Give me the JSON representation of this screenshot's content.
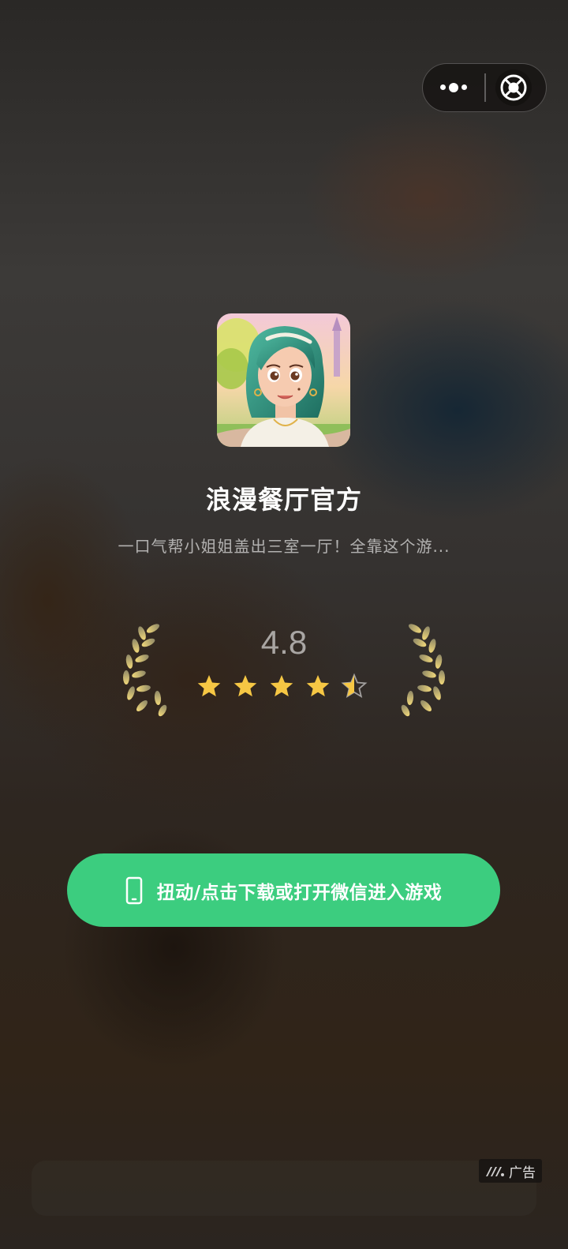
{
  "capsule": {
    "more_icon": "more-dots-icon",
    "close_icon": "target-close-icon"
  },
  "app": {
    "name": "浪漫餐厅官方",
    "description": "一口气帮小姐姐盖出三室一厅！全靠这个游...",
    "icon": "game-character-avatar"
  },
  "rating": {
    "score": "4.8",
    "stars": 4.5,
    "max_stars": 5
  },
  "cta": {
    "label": "扭动/点击下载或打开微信进入游戏",
    "icon": "phone-icon",
    "color": "#3ccd7f"
  },
  "ad": {
    "label": "广告",
    "icon": "ad-logo-icon"
  }
}
